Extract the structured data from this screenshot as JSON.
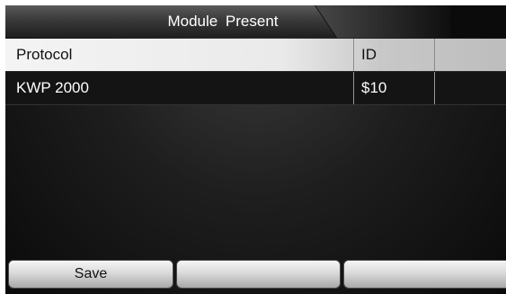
{
  "header": {
    "title": "Module  Present"
  },
  "table": {
    "columns": [
      "Protocol",
      "ID",
      ""
    ],
    "rows": [
      {
        "protocol": "KWP 2000",
        "id": "$10",
        "extra": ""
      }
    ]
  },
  "buttons": [
    {
      "label": "Save"
    },
    {
      "label": ""
    },
    {
      "label": ""
    }
  ]
}
